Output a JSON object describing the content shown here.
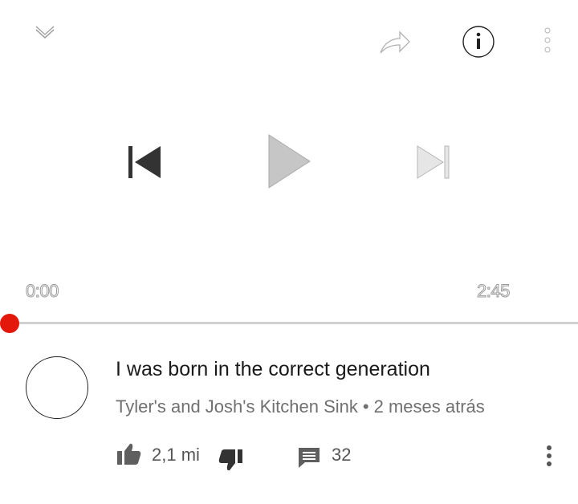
{
  "topbar": {
    "collapse_icon": "chevron-down-icon",
    "share_icon": "share-icon",
    "info_icon": "info-icon",
    "more_icon": "more-vert-icon"
  },
  "transport": {
    "prev_icon": "skip-previous-icon",
    "play_icon": "play-icon",
    "next_icon": "skip-next-icon"
  },
  "progress": {
    "current_time": "0:00",
    "total_time": "2:45",
    "fraction": 0.0,
    "accent_color": "#e3170a"
  },
  "video": {
    "title": "I was born in the correct generation",
    "channel": "Tyler's and Josh's Kitchen Sink",
    "separator": "•",
    "age": "2 meses atrás"
  },
  "actions": {
    "likes": "2,1 mi",
    "comments": "32"
  }
}
